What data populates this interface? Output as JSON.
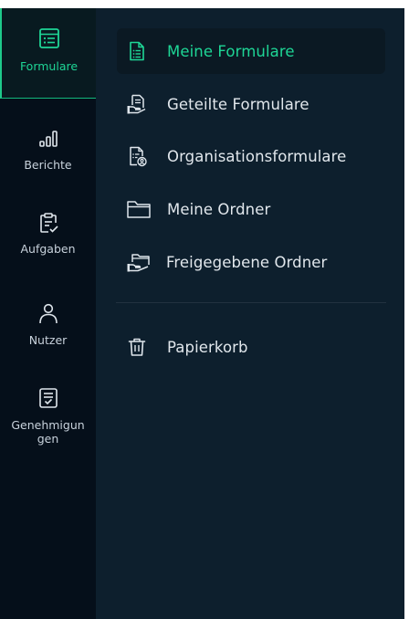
{
  "rail": {
    "items": [
      {
        "label": "Formulare",
        "icon": "form-list-icon",
        "active": true
      },
      {
        "label": "Berichte",
        "icon": "bar-chart-icon",
        "active": false
      },
      {
        "label": "Aufgaben",
        "icon": "clipboard-edit-icon",
        "active": false
      },
      {
        "label": "Nutzer",
        "icon": "user-icon",
        "active": false
      },
      {
        "label": "Genehmigun gen",
        "icon": "approval-doc-icon",
        "active": false
      }
    ]
  },
  "panel": {
    "items": [
      {
        "label": "Meine Formulare",
        "icon": "document-list-icon",
        "active": true
      },
      {
        "label": "Geteilte Formulare",
        "icon": "shared-document-icon",
        "active": false
      },
      {
        "label": "Organisationsformulare",
        "icon": "organization-document-icon",
        "active": false
      },
      {
        "label": "Meine Ordner",
        "icon": "folder-icon",
        "active": false
      },
      {
        "label": "Freigegebene Ordner",
        "icon": "shared-folder-icon",
        "active": false
      }
    ],
    "trash": {
      "label": "Papierkorb",
      "icon": "trash-icon"
    }
  },
  "colors": {
    "rail_bg": "#050f1a",
    "panel_bg": "#0d1f2d",
    "accent": "#1ed696",
    "text": "#e1e7ec"
  }
}
